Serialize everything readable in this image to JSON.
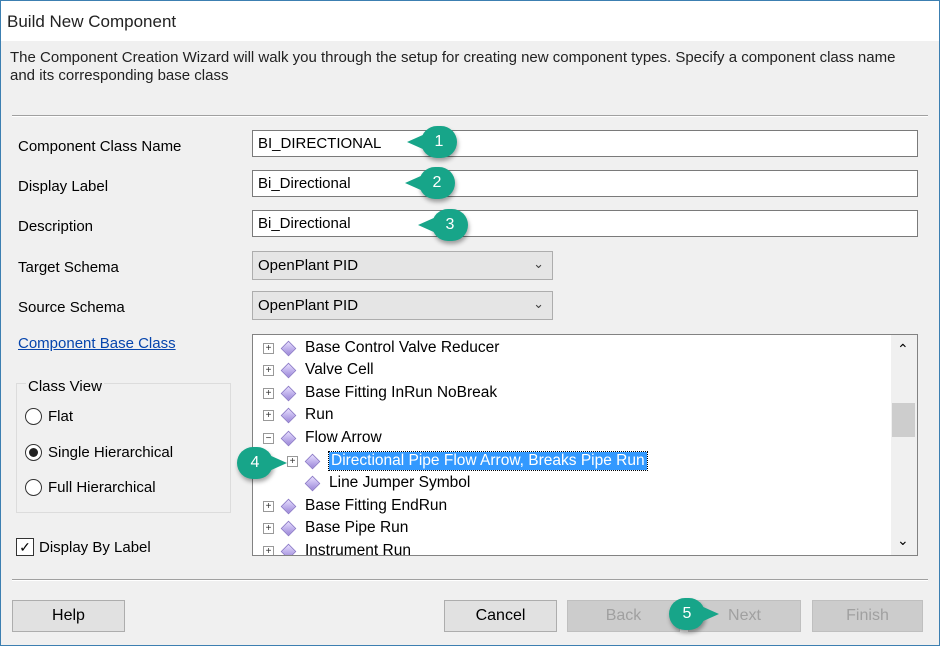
{
  "title": "Build New Component",
  "intro": "The Component Creation Wizard will walk you through the setup for creating new component types.  Specify a component class name and its corresponding base class",
  "fields": {
    "class_name_label": "Component Class Name",
    "class_name": "BI_DIRECTIONAL",
    "display_label_label": "Display Label",
    "display_label": "Bi_Directional",
    "description_label": "Description",
    "description": "Bi_Directional",
    "target_schema_label": "Target Schema",
    "target_schema": "OpenPlant PID",
    "source_schema_label": "Source Schema",
    "source_schema": "OpenPlant PID"
  },
  "base_class_link": "Component Base Class",
  "class_view": {
    "title": "Class View",
    "flat": "Flat",
    "single": "Single Hierarchical",
    "full": "Full Hierarchical"
  },
  "display_by_label": "Display By Label",
  "tree": [
    "Base Control Valve Reducer",
    "Valve Cell",
    "Base Fitting InRun NoBreak",
    "Run",
    "Flow Arrow",
    "Directional Pipe Flow Arrow, Breaks Pipe Run",
    "Line Jumper Symbol",
    "Base Fitting EndRun",
    "Base Pipe Run",
    "Instrument Run"
  ],
  "buttons": {
    "help": "Help",
    "cancel": "Cancel",
    "back": "Back",
    "next": "Next",
    "finish": "Finish"
  },
  "callouts": [
    "1",
    "2",
    "3",
    "4",
    "5"
  ],
  "colors": {
    "callout": "#17a589",
    "selection": "#3399ff"
  }
}
